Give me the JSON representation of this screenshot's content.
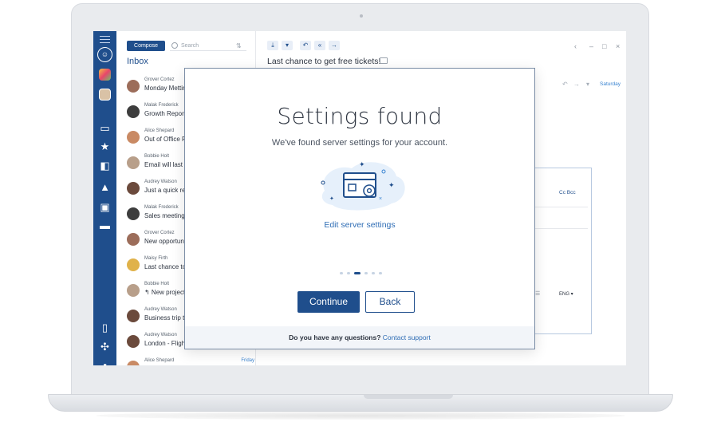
{
  "sidebar": {
    "icons": [
      "menu-icon",
      "account-icon",
      "app-colorful-icon",
      "app-photo-icon",
      "inbox-icon",
      "star-icon",
      "badge-icon",
      "send-icon",
      "briefcase-icon",
      "folder-icon",
      "file-icon",
      "slack-icon",
      "fb-icon"
    ]
  },
  "list": {
    "compose_label": "Compose",
    "search_placeholder": "Search",
    "title": "Inbox",
    "items": [
      {
        "sender": "Grover Cortez",
        "subject": "Monday Metting"
      },
      {
        "sender": "Malak Frederick",
        "subject": "Growth Report -"
      },
      {
        "sender": "Alice Shepard",
        "subject": "Out of Office Re"
      },
      {
        "sender": "Bobbie Holt",
        "subject": "Email will last fo"
      },
      {
        "sender": "Audrey Watson",
        "subject": "Just a quick rem"
      },
      {
        "sender": "Malak Frederick",
        "subject": "Sales meeting d"
      },
      {
        "sender": "Grover Cortez",
        "subject": "New opportunit"
      },
      {
        "sender": "Maisy Firth",
        "subject": "Last chance to g"
      },
      {
        "sender": "Bobbie Holt",
        "subject": "↰ New project k"
      },
      {
        "sender": "Audrey Watson",
        "subject": "Business trip to"
      },
      {
        "sender": "Audrey Watson",
        "subject": "London - Flight"
      },
      {
        "sender": "Alice Shepard",
        "subject": "",
        "date": "Friday"
      }
    ]
  },
  "reader": {
    "subject": "Last chance to get free tickets!",
    "date": "Saturday",
    "cc": "Cc  Bcc",
    "lang": "ENG ▾"
  },
  "dialog": {
    "title": "Settings found",
    "subtitle": "We've found server settings for your account.",
    "edit_link": "Edit server settings",
    "continue_label": "Continue",
    "back_label": "Back",
    "footer_question": "Do you have any questions?",
    "footer_link": "Contact support",
    "step_current": 3,
    "step_total": 6
  },
  "colors": {
    "brand": "#1f4e8c",
    "link": "#2f6db5",
    "sidebar": "#1f4e8c"
  }
}
